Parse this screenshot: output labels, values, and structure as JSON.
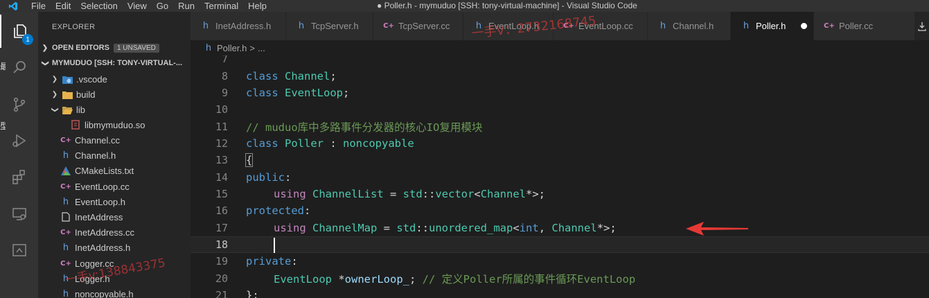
{
  "menu": [
    "File",
    "Edit",
    "Selection",
    "View",
    "Go",
    "Run",
    "Terminal",
    "Help"
  ],
  "window_title": "● Poller.h - mymuduo [SSH: tony-virtual-machine] - Visual Studio Code",
  "activity": {
    "explorer_badge": "1",
    "edge_chars": [
      "最",
      "型"
    ]
  },
  "sidebar": {
    "header": "EXPLORER",
    "open_editors": "OPEN EDITORS",
    "unsaved_badge": "1 UNSAVED",
    "project": "MYMUDUO [SSH: TONY-VIRTUAL-...",
    "items": [
      {
        "label": ".vscode",
        "icon": "vscode-folder-icon"
      },
      {
        "label": "build",
        "icon": "folder-icon"
      },
      {
        "label": "lib",
        "icon": "folder-open-icon"
      },
      {
        "label": "libmymuduo.so",
        "icon": "binary-file-icon"
      },
      {
        "label": "Channel.cc",
        "icon": "cpp-file-icon"
      },
      {
        "label": "Channel.h",
        "icon": "h-file-icon"
      },
      {
        "label": "CMakeLists.txt",
        "icon": "cmake-icon"
      },
      {
        "label": "EventLoop.cc",
        "icon": "cpp-file-icon"
      },
      {
        "label": "EventLoop.h",
        "icon": "h-file-icon"
      },
      {
        "label": "InetAddress",
        "icon": "file-icon"
      },
      {
        "label": "InetAddress.cc",
        "icon": "cpp-file-icon"
      },
      {
        "label": "InetAddress.h",
        "icon": "h-file-icon"
      },
      {
        "label": "Logger.cc",
        "icon": "cpp-file-icon"
      },
      {
        "label": "Logger.h",
        "icon": "h-file-icon"
      },
      {
        "label": "noncopyable.h",
        "icon": "h-file-icon"
      }
    ]
  },
  "tabs": [
    {
      "label": "InetAddress.h",
      "icon": "h-file-icon"
    },
    {
      "label": "TcpServer.h",
      "icon": "h-file-icon"
    },
    {
      "label": "TcpServer.cc",
      "icon": "cpp-file-icon"
    },
    {
      "label": "EventLoop.h",
      "icon": "h-file-icon"
    },
    {
      "label": "EventLoop.cc",
      "icon": "cpp-file-icon"
    },
    {
      "label": "Channel.h",
      "icon": "h-file-icon"
    },
    {
      "label": "Poller.h",
      "icon": "h-file-icon",
      "active": true,
      "dirty": true
    },
    {
      "label": "Poller.cc",
      "icon": "cpp-file-icon"
    }
  ],
  "breadcrumb": {
    "file": "Poller.h",
    "sep": ">",
    "rest": "..."
  },
  "editor": {
    "line_numbers": [
      "7",
      "8",
      "9",
      "10",
      "11",
      "12",
      "13",
      "14",
      "15",
      "16",
      "17",
      "18",
      "19",
      "20",
      "21"
    ],
    "tokens": {
      "l8": [
        "class",
        " ",
        "Channel",
        ";"
      ],
      "l9": [
        "class",
        " ",
        "EventLoop",
        ";"
      ],
      "l11": "// muduo库中多路事件分发器的核心IO复用模块",
      "l12": [
        "class",
        " ",
        "Poller",
        " : ",
        "noncopyable"
      ],
      "l13": "{",
      "l14": [
        "public",
        ":"
      ],
      "l15": [
        "using",
        " ",
        "ChannelList",
        " = ",
        "std",
        "::",
        "vector",
        "<",
        "Channel",
        "*>;"
      ],
      "l16": [
        "protected",
        ":"
      ],
      "l17": [
        "using",
        " ",
        "ChannelMap",
        " = ",
        "std",
        "::",
        "unordered_map",
        "<",
        "int",
        ", ",
        "Channel",
        "*>;"
      ],
      "l19": [
        "private",
        ":"
      ],
      "l20": [
        "EventLoop",
        " *",
        "ownerLoop_",
        "; ",
        "// 定义Poller所属的事件循环EventLoop"
      ],
      "l21": "};"
    }
  },
  "watermarks": {
    "top": "一手V：2732168745",
    "left": "一手v:138843375"
  },
  "colors": {
    "accent": "#007acc",
    "arrow": "#e53935"
  }
}
